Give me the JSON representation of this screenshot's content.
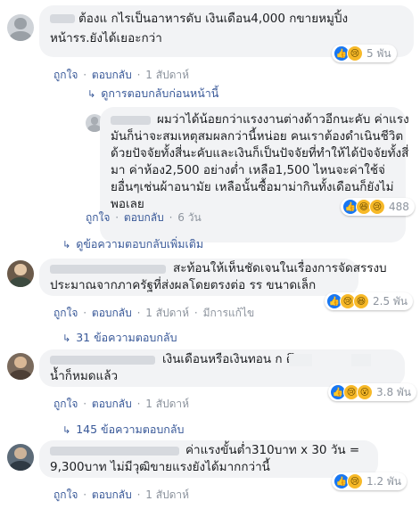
{
  "comments": [
    {
      "lines": [
        "ต้องแ  กไรเป็นอาหารดับ เงินเดือน4,000 กขายหมูปิ้ง",
        "หน้ารร.ยังได้เยอะกว่า"
      ],
      "like": "ถูกใจ",
      "reply": "ตอบกลับ",
      "time": "1 สัปดาห์",
      "reaction_count": "5 พัน",
      "reactions": [
        "like-icon",
        "sad-icon"
      ]
    },
    {
      "lines": [
        "ผมว่าได้น้อยกว่าแรงงานต่างด้าวอีกนะคับ ค่าแรง",
        "มันก็น่าจะสมเหตุสมผลกว่านี้หน่อย คนเราต้องดำเนินชีวิต",
        "ด้วยปัจจัยทั้งสี่นะคับและเงินก็เป็นปัจจัยที่ทำให้ได้ปัจจัยทั้งสี่",
        "มา ค่าห้อง2,500 อย่างต่ำ เหลือ1,500 ไหนจะค่าใช้จ่",
        "ยอื่นๆเช่นผ้าอนามัย เหลือนั้นซื้อมาม่ากินทั้งเดือนก็ยังไม่",
        "พอเลย"
      ],
      "like": "ถูกใจ",
      "reply": "ตอบกลับ",
      "time": "6 วัน",
      "reaction_count": "488",
      "reactions": [
        "like-icon",
        "haha-icon",
        "sad-icon"
      ]
    },
    {
      "lines": [
        "สะท้อนให้เห็นชัดเจนในเรื่องการจัดสรรงบ",
        "ประมาณจากภาครัฐที่ส่งผลโดยตรงต่อ รร ขนาดเล็ก"
      ],
      "like": "ถูกใจ",
      "reply": "ตอบกลับ",
      "time": "1 สัปดาห์",
      "edited": "มีการแก้ไข",
      "reaction_count": "2.5 พัน",
      "reactions": [
        "like-icon",
        "sad-icon",
        "haha-icon"
      ]
    },
    {
      "lines": [
        "เงินเดือนหรือเงินทอน        ก ตึก         2",
        "น้ำก็หมดแล้ว"
      ],
      "like": "ถูกใจ",
      "reply": "ตอบกลับ",
      "time": "1 สัปดาห์",
      "reaction_count": "3.8 พัน",
      "reactions": [
        "like-icon",
        "sad-icon",
        "wow-icon"
      ]
    },
    {
      "lines": [
        "ค่าแรงขั้นต่ำ310บาท x 30 วัน =",
        "9,300บาท ไม่มีวุฒิขายแรงยังได้มากกว่านี้"
      ],
      "like": "ถูกใจ",
      "reply": "ตอบกลับ",
      "time": "1 สัปดาห์",
      "reaction_count": "1.2 พัน",
      "reactions": [
        "like-icon",
        "sad-icon"
      ]
    }
  ],
  "reply_links": {
    "previous_replies": "ดูการตอบกลับก่อนหน้านี้",
    "more_replies": "ดูข้อความตอบกลับเพิ่มเติม",
    "replies_31": "31 ข้อความตอบกลับ",
    "replies_145": "145 ข้อความตอบกลับ"
  },
  "separator": "·",
  "colors": {
    "bubble": "#f2f3f5",
    "link": "#385898",
    "meta": "#8d949e",
    "like": "#1877f2",
    "emoji": "#f7b928"
  }
}
